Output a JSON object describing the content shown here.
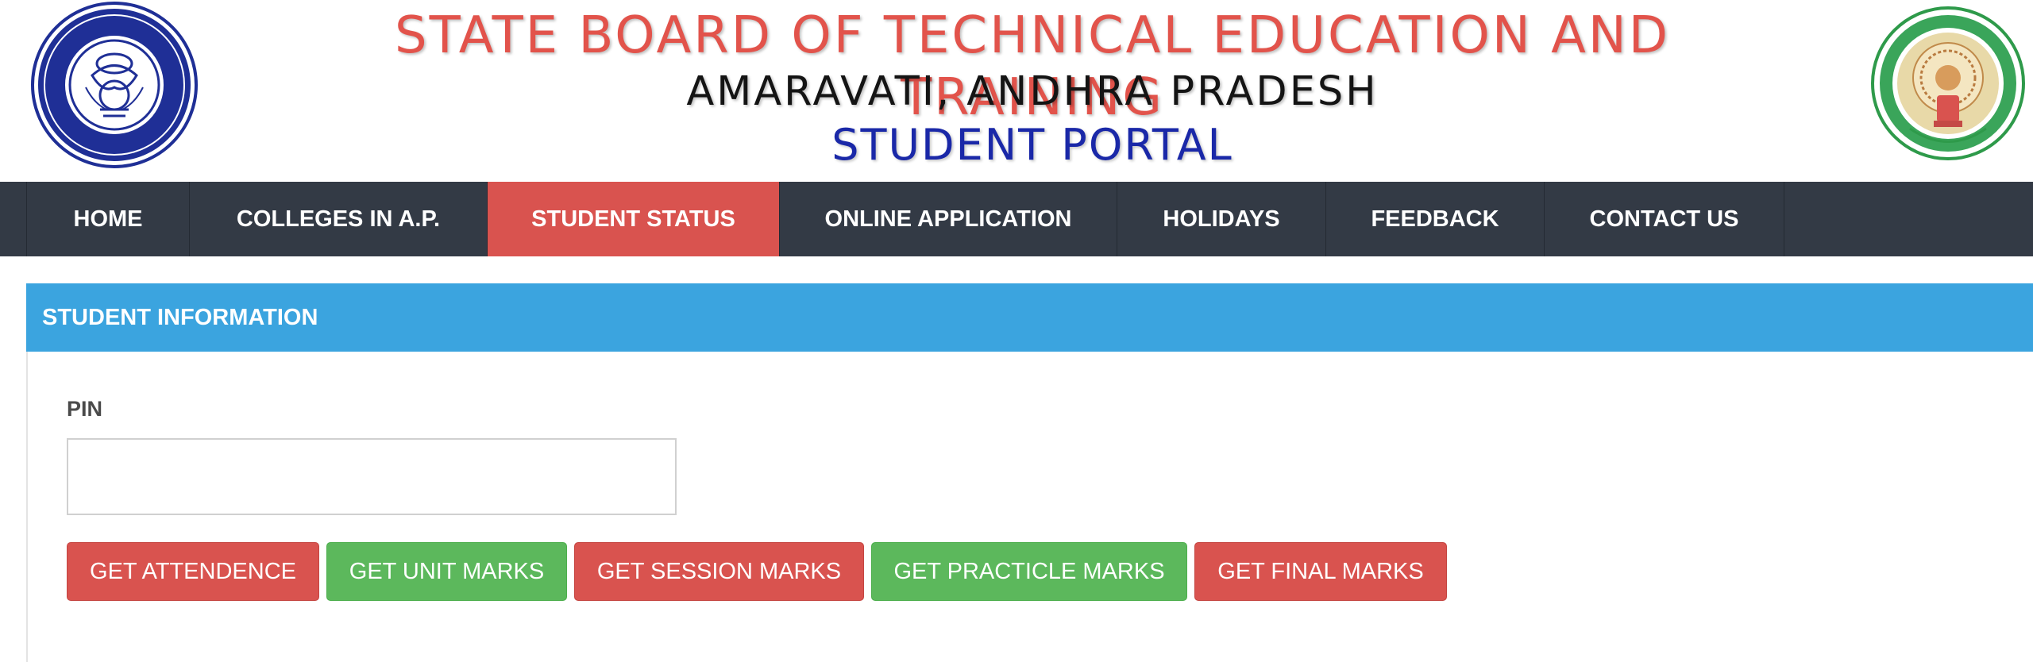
{
  "header": {
    "title": "STATE BOARD OF TECHNICAL EDUCATION AND TRAINING",
    "location": "AMARAVATI, ANDHRA PRADESH",
    "portal": "STUDENT PORTAL"
  },
  "nav": {
    "items": [
      {
        "label": "HOME"
      },
      {
        "label": "COLLEGES IN A.P."
      },
      {
        "label": "STUDENT STATUS",
        "active": true
      },
      {
        "label": "ONLINE APPLICATION"
      },
      {
        "label": "HOLIDAYS"
      },
      {
        "label": "FEEDBACK"
      },
      {
        "label": "CONTACT US"
      }
    ]
  },
  "panel": {
    "title": "STUDENT INFORMATION",
    "pin_label": "PIN",
    "pin_value": "",
    "buttons": [
      {
        "label": "GET ATTENDENCE",
        "color": "red"
      },
      {
        "label": "GET UNIT MARKS",
        "color": "green"
      },
      {
        "label": "GET SESSION MARKS",
        "color": "red"
      },
      {
        "label": "GET PRACTICLE MARKS",
        "color": "green"
      },
      {
        "label": "GET FINAL MARKS",
        "color": "red"
      }
    ]
  },
  "colors": {
    "nav_bg": "#333a45",
    "active_tab": "#d9534f",
    "panel_header": "#3ba4df",
    "button_red": "#d9534f",
    "button_green": "#5cb85c",
    "title_red": "#e2534b",
    "portal_blue": "#1a28a8"
  },
  "logos": {
    "left": "sbtet-emblem",
    "right": "andhra-pradesh-government-seal"
  }
}
